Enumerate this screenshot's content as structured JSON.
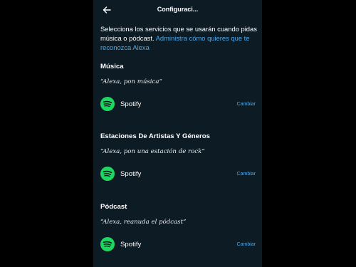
{
  "header": {
    "title": "Configuraci..."
  },
  "intro": {
    "text": "Selecciona los servicios que se usarán cuando pidas música o pódcast. ",
    "link": "Administra cómo quieres que te reconozca Alexa"
  },
  "sections": [
    {
      "title": "Música",
      "example": "“Alexa, pon música”",
      "provider": "Spotify",
      "change_label": "Cambiar"
    },
    {
      "title": "Estaciones De Artistas Y Géneros",
      "example": "“Alexa, pon una estación de rock”",
      "provider": "Spotify",
      "change_label": "Cambiar"
    },
    {
      "title": "Pódcast",
      "example": "“Alexa, reanuda el pódcast”",
      "provider": "Spotify",
      "change_label": "Cambiar"
    }
  ],
  "colors": {
    "background": "#0d1b24",
    "accent_link": "#4fa8e6",
    "spotify_green": "#1ed760"
  },
  "icons": {
    "back": "arrow-left-icon",
    "provider": "spotify-icon"
  }
}
